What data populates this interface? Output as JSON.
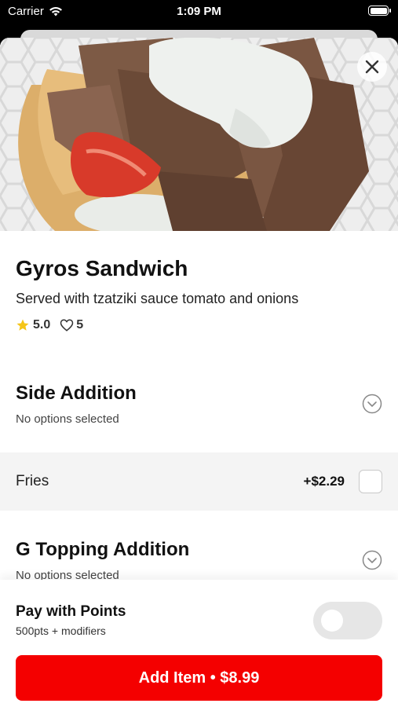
{
  "status_bar": {
    "carrier": "Carrier",
    "time": "1:09 PM"
  },
  "item": {
    "title": "Gyros Sandwich",
    "description": "Served with tzatziki sauce tomato and onions",
    "rating": "5.0",
    "likes": "5"
  },
  "sections": [
    {
      "title": "Side Addition",
      "subtitle": "No options selected",
      "options": [
        {
          "name": "Fries",
          "price": "+$2.29",
          "checked": false
        }
      ]
    },
    {
      "title": "G Topping Addition",
      "subtitle": "No options selected"
    }
  ],
  "points": {
    "title": "Pay with Points",
    "subtitle": "500pts + modifiers",
    "enabled": false
  },
  "add_button": {
    "label": "Add Item • $8.99"
  },
  "icons": {
    "close": "close-icon",
    "rating": "star-icon",
    "likes": "heart-icon",
    "expand": "chevron-down-circle-icon",
    "wifi": "wifi-icon",
    "battery": "battery-icon"
  },
  "colors": {
    "accent": "#f40000",
    "star": "#f5c518",
    "toggle_off": "#e6e6e6"
  }
}
